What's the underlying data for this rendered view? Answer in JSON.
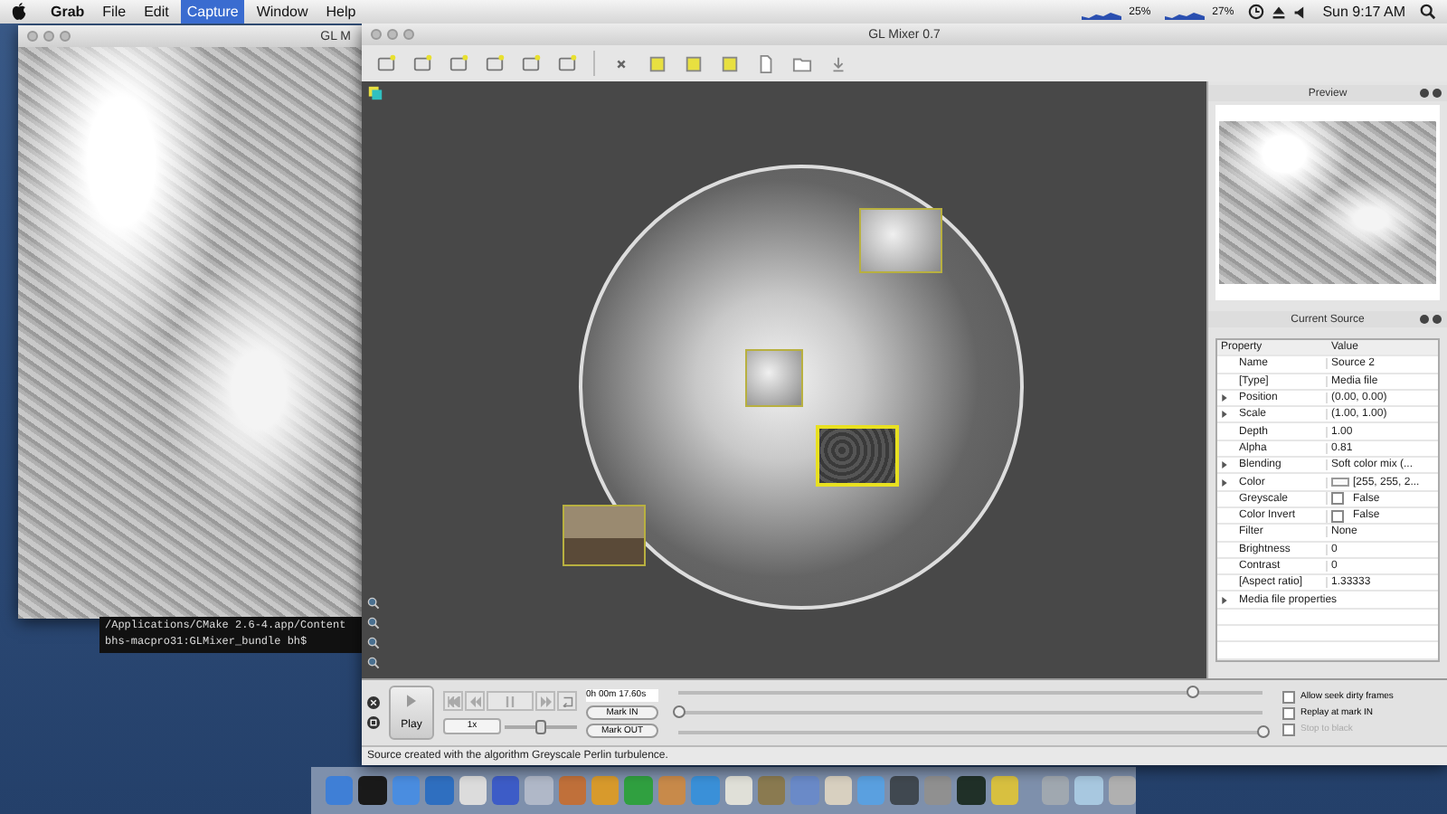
{
  "menubar": {
    "items": [
      {
        "label": "Grab",
        "selected": false
      },
      {
        "label": "File",
        "selected": false
      },
      {
        "label": "Edit",
        "selected": false
      },
      {
        "label": "Capture",
        "selected": true
      },
      {
        "label": "Window",
        "selected": false
      },
      {
        "label": "Help",
        "selected": false
      }
    ],
    "meters": [
      "25%",
      "27%"
    ],
    "clock": "Sun 9:17 AM"
  },
  "left_window": {
    "title": "GL M"
  },
  "terminal": {
    "lines": [
      "/Applications/CMake 2.6-4.app/Content",
      "bhs-macpro31:GLMixer_bundle bh$"
    ]
  },
  "main_window": {
    "title": "GL Mixer 0.7"
  },
  "canvas": {
    "sources": [
      {
        "kind": "texture",
        "selected": false
      },
      {
        "kind": "texture",
        "selected": false
      },
      {
        "kind": "dark",
        "selected": true
      },
      {
        "kind": "photo",
        "selected": false
      }
    ]
  },
  "preview": {
    "title": "Preview"
  },
  "current_source": {
    "title": "Current Source",
    "columns": [
      "Property",
      "Value"
    ],
    "rows": [
      {
        "property": "Name",
        "value": "Source 2",
        "expandable": false,
        "kind": "text"
      },
      {
        "property": "[Type]",
        "value": "Media file",
        "expandable": false,
        "kind": "text"
      },
      {
        "property": "Position",
        "value": "(0.00, 0.00)",
        "expandable": true,
        "kind": "text"
      },
      {
        "property": "Scale",
        "value": "(1.00, 1.00)",
        "expandable": true,
        "kind": "text"
      },
      {
        "property": "Depth",
        "value": "1.00",
        "expandable": false,
        "kind": "text"
      },
      {
        "property": "Alpha",
        "value": "0.81",
        "expandable": false,
        "kind": "text"
      },
      {
        "property": "Blending",
        "value": "Soft color mix (...",
        "expandable": true,
        "kind": "text"
      },
      {
        "property": "Color",
        "value": "[255, 255, 2...",
        "expandable": true,
        "kind": "color"
      },
      {
        "property": "Greyscale",
        "value": "False",
        "expandable": false,
        "kind": "checkbox",
        "checked": false
      },
      {
        "property": "Color Invert",
        "value": "False",
        "expandable": false,
        "kind": "checkbox",
        "checked": false
      },
      {
        "property": "Filter",
        "value": "None",
        "expandable": false,
        "kind": "text"
      },
      {
        "property": "Brightness",
        "value": "0",
        "expandable": false,
        "kind": "text"
      },
      {
        "property": "Contrast",
        "value": "0",
        "expandable": false,
        "kind": "text"
      },
      {
        "property": "[Aspect ratio]",
        "value": "1.33333",
        "expandable": false,
        "kind": "text"
      },
      {
        "property": "Media file properties",
        "value": "",
        "expandable": true,
        "kind": "group"
      }
    ]
  },
  "controls": {
    "play": "Play",
    "speed": "1x",
    "speed_slider": {
      "level": 0.5
    },
    "time": "0h 00m 17.60s",
    "mark_in": "Mark IN",
    "mark_out": "Mark OUT",
    "sliders": [
      {
        "level": 0.88
      },
      {
        "level": 0.0
      },
      {
        "level": 1.0
      }
    ],
    "options": [
      {
        "label": "Allow seek dirty frames",
        "checked": false,
        "disabled": false
      },
      {
        "label": "Replay at mark IN",
        "checked": false,
        "disabled": false
      },
      {
        "label": "Stop to black",
        "checked": false,
        "disabled": true
      }
    ]
  },
  "status_bar": {
    "text": "Source created with the algorithm Greyscale Perlin turbulence."
  },
  "dock": {
    "items": [
      {
        "color": "#3f7fd6"
      },
      {
        "color": "#1a1a1a"
      },
      {
        "color": "#4a8de0"
      },
      {
        "color": "#2f6fc0"
      },
      {
        "color": "#dcdcdc"
      },
      {
        "color": "#3d5cc7"
      },
      {
        "color": "#b0b8c8"
      },
      {
        "color": "#c0703a"
      },
      {
        "color": "#d89a2c"
      },
      {
        "color": "#30a040"
      },
      {
        "color": "#c88a4a"
      },
      {
        "color": "#3a90d8"
      },
      {
        "color": "#e0e0d8"
      },
      {
        "color": "#8a7a50"
      },
      {
        "color": "#6a8ac8"
      },
      {
        "color": "#d8d0c0"
      },
      {
        "color": "#5aa0e0"
      },
      {
        "color": "#404850"
      },
      {
        "color": "#909090"
      },
      {
        "color": "#203028"
      },
      {
        "color": "#d8c040"
      },
      {
        "color": "#a0a8b0"
      },
      {
        "color": "#a8c8e0"
      },
      {
        "color": "#b0b0b0"
      }
    ]
  }
}
